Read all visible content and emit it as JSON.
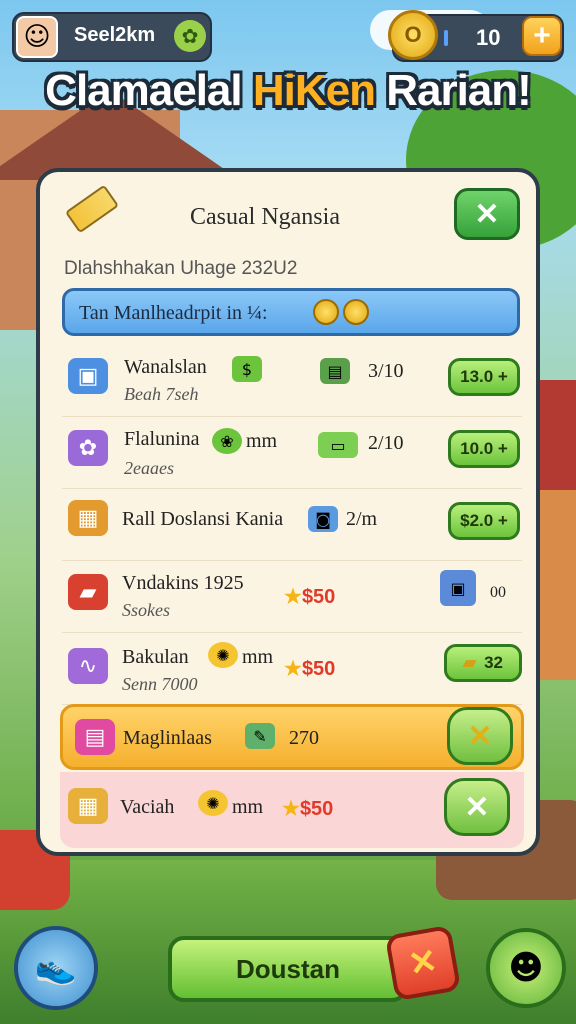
{
  "hud": {
    "player_name": "Seel2km",
    "coin_count": "10",
    "plus_label": "+",
    "coin_symbol": "O"
  },
  "banner": {
    "title_part1": "Clamaelal ",
    "title_part2": "HiKen",
    "title_part3": " Rarian!"
  },
  "panel": {
    "title": "Casual Ngansia",
    "close_label": "✕",
    "subtitle": "Dlahshhakan Uhage 232U2",
    "info_text": "Tan Manlheadrpit in ¼:"
  },
  "items": [
    {
      "name": "Wanalslan",
      "sub": "Beah 7seh",
      "mid": "3/10",
      "price": "13.0 +"
    },
    {
      "name": "Flalunina",
      "sub": "2eaaes",
      "mid": "2/10",
      "extra": "mm",
      "price": "10.0 +"
    },
    {
      "name": "Rall Doslansi Kania",
      "mid": "2/m",
      "price": "$2.0 +"
    },
    {
      "name": "Vndakins 1925",
      "sub": "Ssokes",
      "star_price": "$50",
      "extra": "00"
    },
    {
      "name": "Bakulan",
      "sub": "Senn 7000",
      "extra": "mm",
      "star_price": "$50",
      "price": "32"
    }
  ],
  "highlight_rows": [
    {
      "name": "Maglinlaas",
      "mid": "270",
      "btn": "✕"
    },
    {
      "name": "Vaciah",
      "extra": "mm",
      "star_price": "$50",
      "btn": "✕"
    }
  ],
  "bottom": {
    "main_button": "Doustan",
    "close_label": "✕"
  },
  "colors": {
    "accent_green": "#63bf33",
    "title_highlight": "#ffb020",
    "price_red": "#e23a2a",
    "info_blue": "#5aa6ea"
  }
}
